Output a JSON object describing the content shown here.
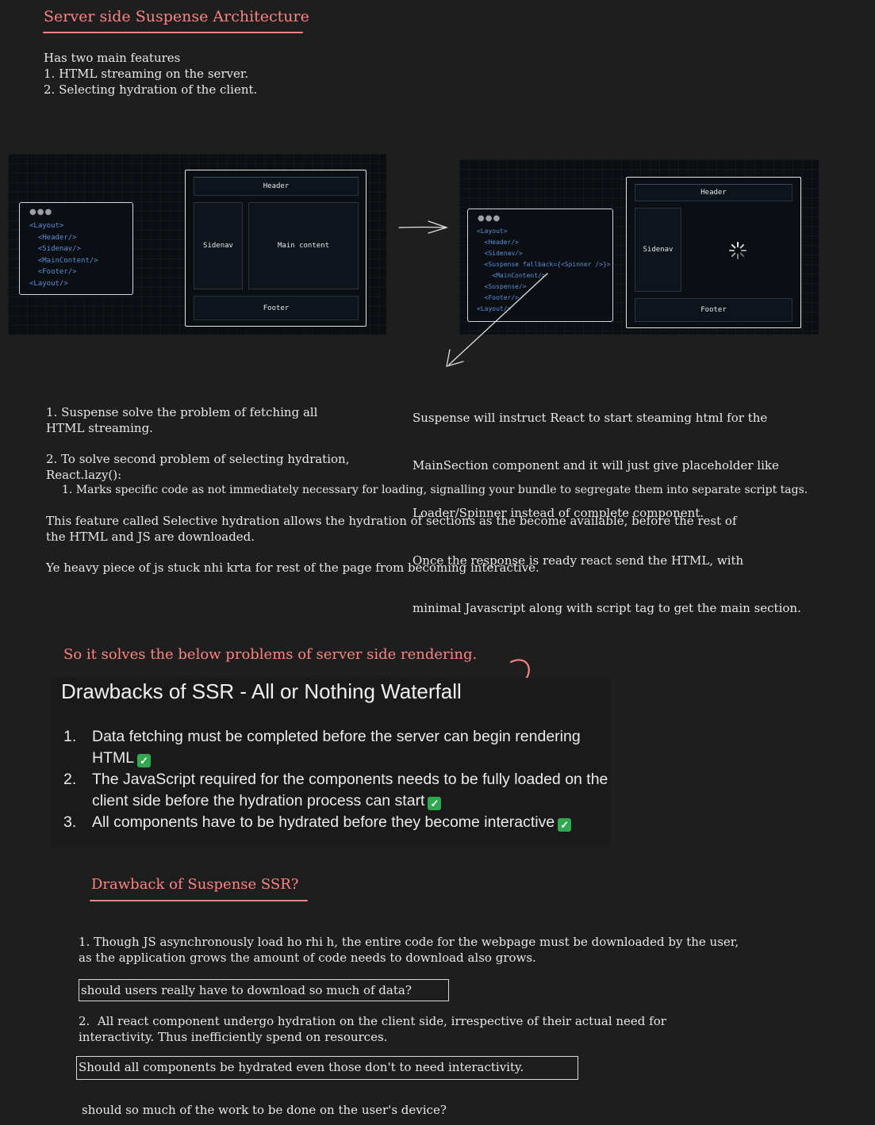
{
  "header": {
    "title": "Server side Suspense Architecture"
  },
  "intro": {
    "line1": "Has two main features",
    "line2": "1. HTML streaming on the server.",
    "line3": "2. Selecting hydration of the client."
  },
  "diagram_left": {
    "code_lines": [
      "<Layout>",
      "  <Header/>",
      "  <Sidenav/>",
      "  <MainContent/>",
      "  <Footer/>",
      "<Layout/>"
    ],
    "header_label": "Header",
    "sidenav_label": "Sidenav",
    "main_label": "Main content",
    "footer_label": "Footer"
  },
  "diagram_right": {
    "code_lines": [
      "<Layout>",
      "  <Header/>",
      "  <Sidenav/>",
      "  <Suspense fallback={<Spinner />}>",
      "    <MainContent/>",
      "  <Suspense/>",
      "  <Footer/>",
      "<Layout/>"
    ],
    "header_label": "Header",
    "sidenav_label": "Sidenav",
    "footer_label": "Footer"
  },
  "note_right": {
    "lines": [
      "Suspense will instruct React to start steaming html for the",
      "MainSection component and it will just give placeholder like",
      "Loader/Spinner instead of complete component.",
      "Once the response is ready react send the HTML, with",
      "minimal Javascript along with script tag to get the main section."
    ]
  },
  "notes_left": {
    "p1_line1": "1. Suspense solve the problem of fetching all",
    "p1_line2": "HTML streaming.",
    "p2_line1": "2. To solve second problem of selecting hydration,",
    "p2_line2": "React.lazy():",
    "p2_line3": "1. Marks specific code as not immediately necessary for loading, signalling your bundle to segregate them into separate script tags.",
    "p3_line1": "This feature called Selective hydration allows the hydration of sections as the become available, before the rest of",
    "p3_line2": "the HTML and JS are downloaded.",
    "p4": "Ye heavy piece of js stuck nhi krta for rest of the page from becoming interactive."
  },
  "solves": {
    "heading": "So it solves the below problems of server side rendering."
  },
  "ssr_card": {
    "title": "Drawbacks of SSR - All or Nothing Waterfall",
    "items": [
      {
        "num": "1.",
        "line1": "Data fetching must be completed before the server can begin rendering",
        "line2": "HTML"
      },
      {
        "num": "2.",
        "line1": "The JavaScript required for the components needs to be fully loaded on the",
        "line2": "client side before the hydration process can start"
      },
      {
        "num": "3.",
        "line1": "All components have to be hydrated before they become interactive",
        "line2": ""
      }
    ]
  },
  "drawback": {
    "title": "Drawback of Suspense SSR?",
    "p1_line1": "1. Though JS asynchronously load ho rhi h, the entire code for the webpage must be downloaded by the user,",
    "p1_line2": "as the application grows the amount of code needs to download also grows.",
    "q1": "should users really have to download so much of data?",
    "p2_line1": "2.  All react component undergo hydration on the client side, irrespective of their actual need for",
    "p2_line2": "interactivity. Thus inefficiently spend on resources.",
    "q2": "Should all components be hydrated even those don't to need interactivity.",
    "q3": "should so much of the work to be done on the user's device?"
  },
  "colors": {
    "accent_red": "#ff8383",
    "background": "#1e1e1e",
    "check_green": "#2fa84f",
    "code_blue": "#5b8fd6"
  }
}
